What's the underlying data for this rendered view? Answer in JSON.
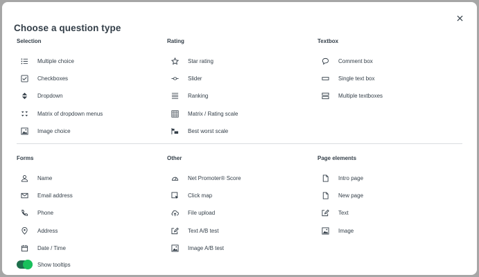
{
  "modal": {
    "title": "Choose a question type",
    "close_icon": "close-icon"
  },
  "sections": {
    "selection": {
      "heading": "Selection",
      "items": [
        {
          "label": "Multiple choice",
          "icon": "list-icon"
        },
        {
          "label": "Checkboxes",
          "icon": "checkbox-icon"
        },
        {
          "label": "Dropdown",
          "icon": "dropdown-icon"
        },
        {
          "label": "Matrix of dropdown menus",
          "icon": "matrix-dropdown-icon"
        },
        {
          "label": "Image choice",
          "icon": "image-icon"
        }
      ]
    },
    "rating": {
      "heading": "Rating",
      "items": [
        {
          "label": "Star rating",
          "icon": "star-icon"
        },
        {
          "label": "Slider",
          "icon": "slider-icon"
        },
        {
          "label": "Ranking",
          "icon": "ranking-icon"
        },
        {
          "label": "Matrix / Rating scale",
          "icon": "grid-icon"
        },
        {
          "label": "Best worst scale",
          "icon": "best-worst-icon"
        }
      ]
    },
    "textbox": {
      "heading": "Textbox",
      "items": [
        {
          "label": "Comment box",
          "icon": "comment-icon"
        },
        {
          "label": "Single text box",
          "icon": "single-textbox-icon"
        },
        {
          "label": "Multiple textboxes",
          "icon": "multiple-textboxes-icon"
        }
      ]
    },
    "forms": {
      "heading": "Forms",
      "items": [
        {
          "label": "Name",
          "icon": "person-icon"
        },
        {
          "label": "Email address",
          "icon": "email-icon"
        },
        {
          "label": "Phone",
          "icon": "phone-icon"
        },
        {
          "label": "Address",
          "icon": "location-pin-icon"
        },
        {
          "label": "Date / Time",
          "icon": "calendar-icon"
        }
      ]
    },
    "other": {
      "heading": "Other",
      "items": [
        {
          "label": "Net Promoter® Score",
          "icon": "gauge-icon"
        },
        {
          "label": "Click map",
          "icon": "click-map-icon"
        },
        {
          "label": "File upload",
          "icon": "upload-cloud-icon"
        },
        {
          "label": "Text A/B test",
          "icon": "edit-box-icon"
        },
        {
          "label": "Image A/B test",
          "icon": "image-icon"
        }
      ]
    },
    "page_elements": {
      "heading": "Page elements",
      "items": [
        {
          "label": "Intro page",
          "icon": "page-icon"
        },
        {
          "label": "New page",
          "icon": "page-icon"
        },
        {
          "label": "Text",
          "icon": "edit-box-icon"
        },
        {
          "label": "Image",
          "icon": "image-icon"
        }
      ]
    }
  },
  "footer": {
    "toggle_label": "Show tooltips",
    "toggle_on": true
  },
  "colors": {
    "toggle_track": "#1e6f4c",
    "toggle_knob": "#19c05b",
    "text": "#333e48"
  }
}
